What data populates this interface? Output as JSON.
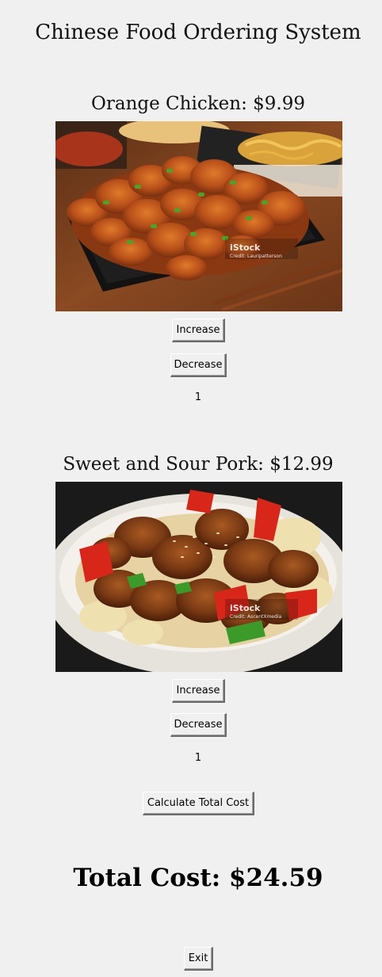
{
  "app": {
    "title": "Chinese Food Ordering System"
  },
  "items": [
    {
      "title": "Orange Chicken: $9.99",
      "image_watermark": "iStock",
      "image_credit": "Credit: Lauripatterson",
      "increase_label": "Increase",
      "decrease_label": "Decrease",
      "quantity": "1"
    },
    {
      "title": "Sweet and Sour Pork: $12.99",
      "image_watermark": "iStock",
      "image_credit": "Credit: AscentXmedia",
      "increase_label": "Increase",
      "decrease_label": "Decrease",
      "quantity": "1"
    }
  ],
  "actions": {
    "calculate_label": "Calculate Total Cost",
    "exit_label": "Exit"
  },
  "total": {
    "text": "Total Cost: $24.59"
  },
  "colors": {
    "background": "#f0f0f0",
    "button_face": "#f0f0f0"
  }
}
